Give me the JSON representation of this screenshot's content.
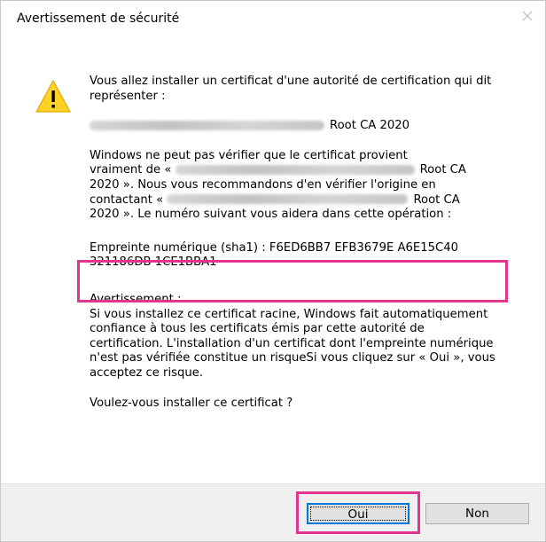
{
  "dialog": {
    "title": "Avertissement de sécurité",
    "close_icon": "close-icon",
    "warning_icon": "warning-triangle-icon"
  },
  "body": {
    "intro": "Vous allez installer un certificat d'une autorité de certification qui dit représenter :",
    "issuer_suffix": "Root CA 2020",
    "para2_line1": "Windows ne peut pas vérifier que le certificat provient",
    "para2_line2_prefix": "vraiment de «",
    "para2_line2_suffix": "Root CA",
    "para2_line3": "2020 ». Nous vous recommandons d'en vérifier l'origine en",
    "para2_line4_prefix": "contactant «",
    "para2_line4_suffix": "Root CA",
    "para2_line5": "2020 ». Le numéro suivant vous aidera dans cette opération :",
    "thumbprint_line1": "Empreinte numérique (sha1) : F6ED6BB7 EFB3679E A6E15C40",
    "thumbprint_line2": "321186DB 1CE1BBA1",
    "warning_heading": "Avertissement :",
    "warning_text": "Si vous installez ce certificat racine, Windows fait automatiquement confiance à tous les certificats émis par cette autorité de certification. L'installation d'un certificat dont l'empreinte numérique n'est pas vérifiée constitue un risqueSi vous cliquez sur « Oui », vous acceptez ce risque.",
    "question": "Voulez-vous installer ce certificat ?"
  },
  "buttons": {
    "yes_label": "Oui",
    "no_label": "Non"
  },
  "colors": {
    "highlight": "#e0368f",
    "focus_border": "#0078d7",
    "footer_bg": "#f0f0f0"
  }
}
